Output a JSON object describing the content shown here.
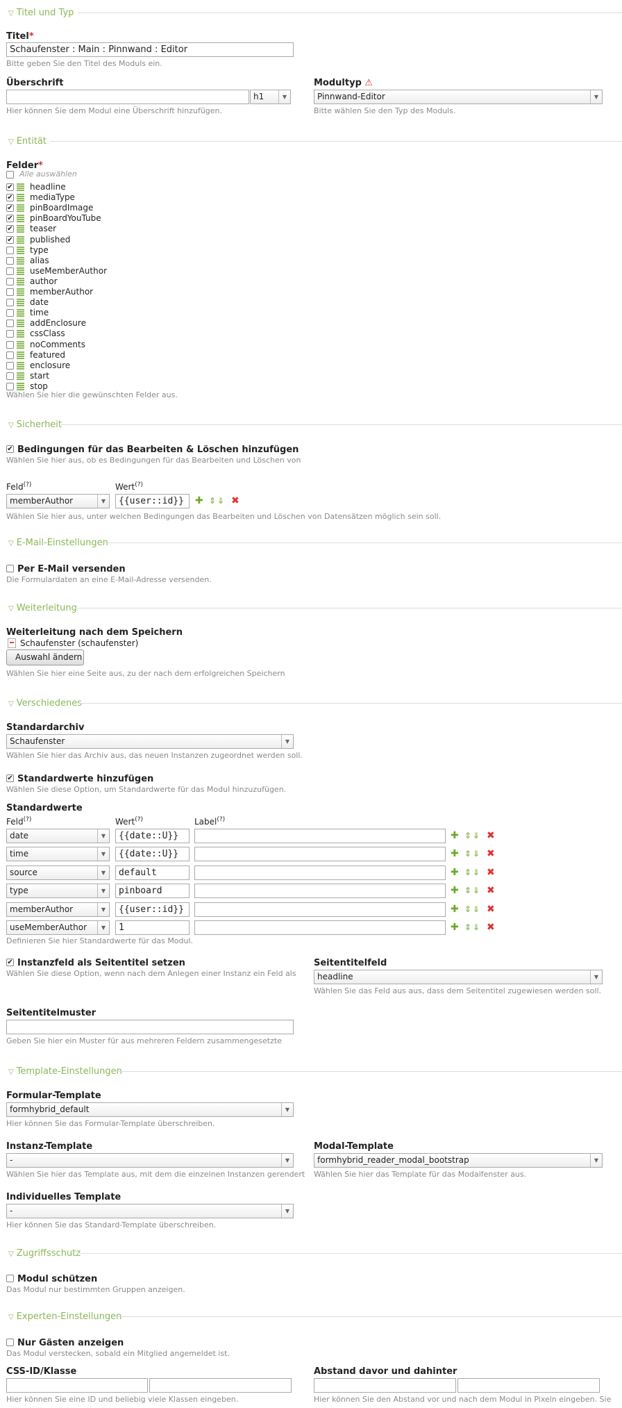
{
  "sections": {
    "titel_typ": "Titel und Typ",
    "entitaet": "Entität",
    "sicherheit": "Sicherheit",
    "email": "E-Mail-Einstellungen",
    "weiterleitung": "Weiterleitung",
    "verschiedenes": "Verschiedenes",
    "template": "Template-Einstellungen",
    "zugriffsschutz": "Zugriffsschutz",
    "experten": "Experten-Einstellungen"
  },
  "titel": {
    "label": "Titel",
    "req": "*",
    "value": "Schaufenster : Main : Pinnwand : Editor",
    "help": "Bitte geben Sie den Titel des Moduls ein."
  },
  "ueberschrift": {
    "label": "Überschrift",
    "value": "",
    "level": "h1",
    "help": "Hier können Sie dem Modul eine Überschrift hinzufügen."
  },
  "modultyp": {
    "label": "Modultyp",
    "value": "Pinnwand-Editor",
    "help": "Bitte wählen Sie den Typ des Moduls."
  },
  "felder": {
    "label": "Felder",
    "req": "*",
    "select_all": "Alle auswählen",
    "items": [
      {
        "name": "headline",
        "checked": "✔"
      },
      {
        "name": "mediaType",
        "checked": "✔"
      },
      {
        "name": "pinBoardImage",
        "checked": "✔"
      },
      {
        "name": "pinBoardYouTube",
        "checked": "✔"
      },
      {
        "name": "teaser",
        "checked": "✔"
      },
      {
        "name": "published",
        "checked": "✔"
      },
      {
        "name": "type",
        "checked": ""
      },
      {
        "name": "alias",
        "checked": ""
      },
      {
        "name": "useMemberAuthor",
        "checked": ""
      },
      {
        "name": "author",
        "checked": ""
      },
      {
        "name": "memberAuthor",
        "checked": ""
      },
      {
        "name": "date",
        "checked": ""
      },
      {
        "name": "time",
        "checked": ""
      },
      {
        "name": "addEnclosure",
        "checked": ""
      },
      {
        "name": "cssClass",
        "checked": ""
      },
      {
        "name": "noComments",
        "checked": ""
      },
      {
        "name": "featured",
        "checked": ""
      },
      {
        "name": "enclosure",
        "checked": ""
      },
      {
        "name": "start",
        "checked": ""
      },
      {
        "name": "stop",
        "checked": ""
      }
    ],
    "help": "Wählen Sie hier die gewünschten Felder aus."
  },
  "bedingungen": {
    "label": "Bedingungen für das Bearbeiten & Löschen hinzufügen",
    "checked": "✔",
    "help": "Wählen Sie hier aus, ob es Bedingungen für das Bearbeiten und Löschen von",
    "col_feld": "Feld",
    "col_wert": "Wert",
    "q": "(?)",
    "row_feld": "memberAuthor",
    "row_wert": "{{user::id}}",
    "help2": "Wählen Sie hier aus, unter welchen Bedingungen das Bearbeiten und Löschen von Datensätzen möglich sein soll."
  },
  "email": {
    "label": "Per E-Mail versenden",
    "checked": "",
    "help": "Die Formulardaten an eine E-Mail-Adresse versenden."
  },
  "weiterleitung": {
    "label": "Weiterleitung nach dem Speichern",
    "page": "Schaufenster (schaufenster)",
    "button": "Auswahl ändern",
    "help": "Wählen Sie hier eine Seite aus, zu der nach dem erfolgreichen Speichern"
  },
  "standardarchiv": {
    "label": "Standardarchiv",
    "value": "Schaufenster",
    "help": "Wählen Sie hier das Archiv aus, das neuen Instanzen zugeordnet werden soll."
  },
  "standardwerte_add": {
    "label": "Standardwerte hinzufügen",
    "checked": "✔",
    "help": "Wählen Sie diese Option, um Standardwerte für das Modul hinzuzufügen."
  },
  "standardwerte": {
    "label": "Standardwerte",
    "col_feld": "Feld",
    "col_wert": "Wert",
    "col_label": "Label",
    "q": "(?)",
    "rows": [
      {
        "feld": "date",
        "wert": "{{date::U}}",
        "label": ""
      },
      {
        "feld": "time",
        "wert": "{{date::U}}",
        "label": ""
      },
      {
        "feld": "source",
        "wert": "default",
        "label": ""
      },
      {
        "feld": "type",
        "wert": "pinboard",
        "label": ""
      },
      {
        "feld": "memberAuthor",
        "wert": "{{user::id}}",
        "label": ""
      },
      {
        "feld": "useMemberAuthor",
        "wert": "1",
        "label": ""
      }
    ],
    "help": "Definieren Sie hier Standardwerte für das Modul."
  },
  "instanzfeld": {
    "label": "Instanzfeld als Seitentitel setzen",
    "checked": "✔",
    "help": "Wählen Sie diese Option, wenn nach dem Anlegen einer Instanz ein Feld als"
  },
  "seitentitelfeld": {
    "label": "Seitentitelfeld",
    "value": "headline",
    "help": "Wählen Sie das Feld aus aus, dass dem Seitentitel zugewiesen werden soll."
  },
  "seitentitelmuster": {
    "label": "Seitentitelmuster",
    "value": "",
    "help": "Geben Sie hier ein Muster für aus mehreren Feldern zusammengesetzte"
  },
  "formular_template": {
    "label": "Formular-Template",
    "value": "formhybrid_default",
    "help": "Hier können Sie das Formular-Template überschreiben."
  },
  "instanz_template": {
    "label": "Instanz-Template",
    "value": "-",
    "help": "Wählen Sie hier das Template aus, mit dem die einzelnen Instanzen gerendert"
  },
  "modal_template": {
    "label": "Modal-Template",
    "value": "formhybrid_reader_modal_bootstrap",
    "help": "Wählen Sie hier das Template für das Modalfenster aus."
  },
  "individuelles_template": {
    "label": "Individuelles Template",
    "value": "-",
    "help": "Hier können Sie das Standard-Template überschreiben."
  },
  "modul_schuetzen": {
    "label": "Modul schützen",
    "checked": "",
    "help": "Das Modul nur bestimmten Gruppen anzeigen."
  },
  "nur_gaesten": {
    "label": "Nur Gästen anzeigen",
    "checked": "",
    "help": "Das Modul verstecken, sobald ein Mitglied angemeldet ist."
  },
  "css_id": {
    "label": "CSS-ID/Klasse",
    "id": "",
    "klasse": "",
    "help": "Hier können Sie eine ID und beliebig viele Klassen eingeben."
  },
  "abstand": {
    "label": "Abstand davor und dahinter",
    "davor": "",
    "dahinter": "",
    "help": "Hier können Sie den Abstand vor und nach dem Modul in Pixeln eingeben. Sie"
  },
  "icons": {
    "legend": "triangle-down-icon",
    "warning": "warning-icon",
    "add": "plus-icon",
    "move": "arrows-icon",
    "delete": "cross-icon",
    "page": "page-icon"
  },
  "colors": {
    "legend": "#8ab858",
    "required": "#cc3333",
    "delete": "#dd3333"
  }
}
